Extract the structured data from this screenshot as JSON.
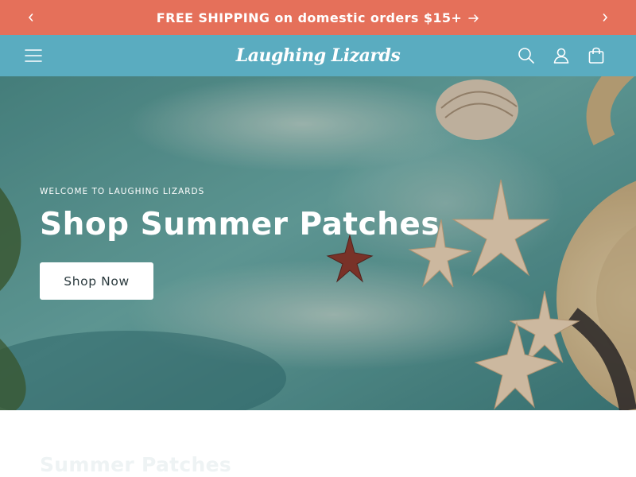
{
  "announcement": {
    "text": "FREE SHIPPING on domestic orders $15+",
    "prev_icon": "chevron-left-icon",
    "next_icon": "chevron-right-icon",
    "link_icon": "arrow-right-icon"
  },
  "header": {
    "logo": "Laughing Lizards",
    "menu_icon": "hamburger-menu-icon",
    "icons": [
      "search-icon",
      "user-icon",
      "bag-icon"
    ],
    "background": "#5aacc0"
  },
  "hero": {
    "eyebrow": "WELCOME TO LAUGHING LIZARDS",
    "title": "Shop Summer Patches",
    "button_label": "Shop Now"
  },
  "section": {
    "title": "Summer Patches"
  },
  "colors": {
    "announcement_bg": "#e5705a",
    "header_bg": "#5aacc0",
    "hero_water": "#5d9a98",
    "button_text": "#2b3a3e"
  }
}
